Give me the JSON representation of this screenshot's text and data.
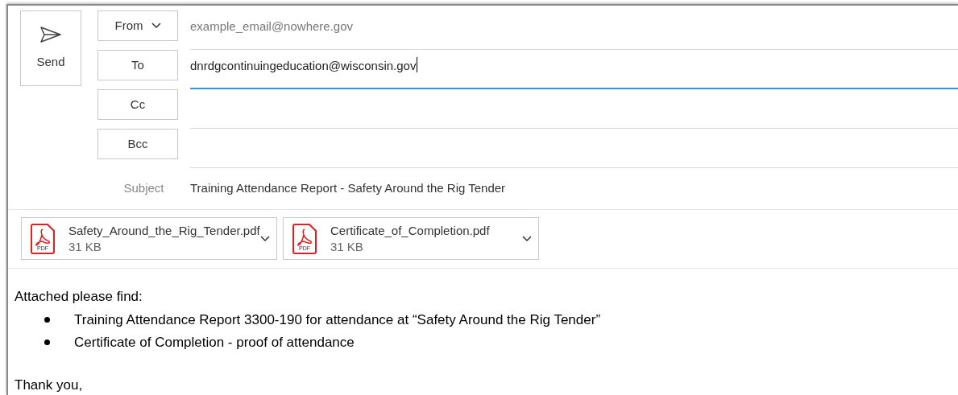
{
  "send_button": {
    "label": "Send"
  },
  "header_fields": [
    {
      "kind": "dropdown",
      "label": "From",
      "value": "example_email@nowhere.gov",
      "focused": false
    },
    {
      "kind": "button",
      "label": "To",
      "value": "dnrdgcontinuingeducation@wisconsin.gov",
      "focused": true
    },
    {
      "kind": "button",
      "label": "Cc",
      "focused": false
    },
    {
      "kind": "button",
      "label": "Bcc",
      "focused": false
    }
  ],
  "subject": {
    "label": "Subject",
    "value": "Training Attendance Report - Safety Around the Rig Tender"
  },
  "attachments": [
    {
      "name": "Safety_Around_the_Rig_Tender.pdf",
      "size": "31 KB",
      "icon_label": "PDF"
    },
    {
      "name": "Certificate_of_Completion.pdf",
      "size": "31 KB",
      "icon_label": "PDF"
    }
  ],
  "body": {
    "intro": "Attached please find:",
    "bullets": [
      "Training Attendance Report 3300-190 for attendance at “Safety Around the Rig Tender”",
      "Certificate of Completion - proof of attendance"
    ],
    "closing": "Thank you,"
  }
}
